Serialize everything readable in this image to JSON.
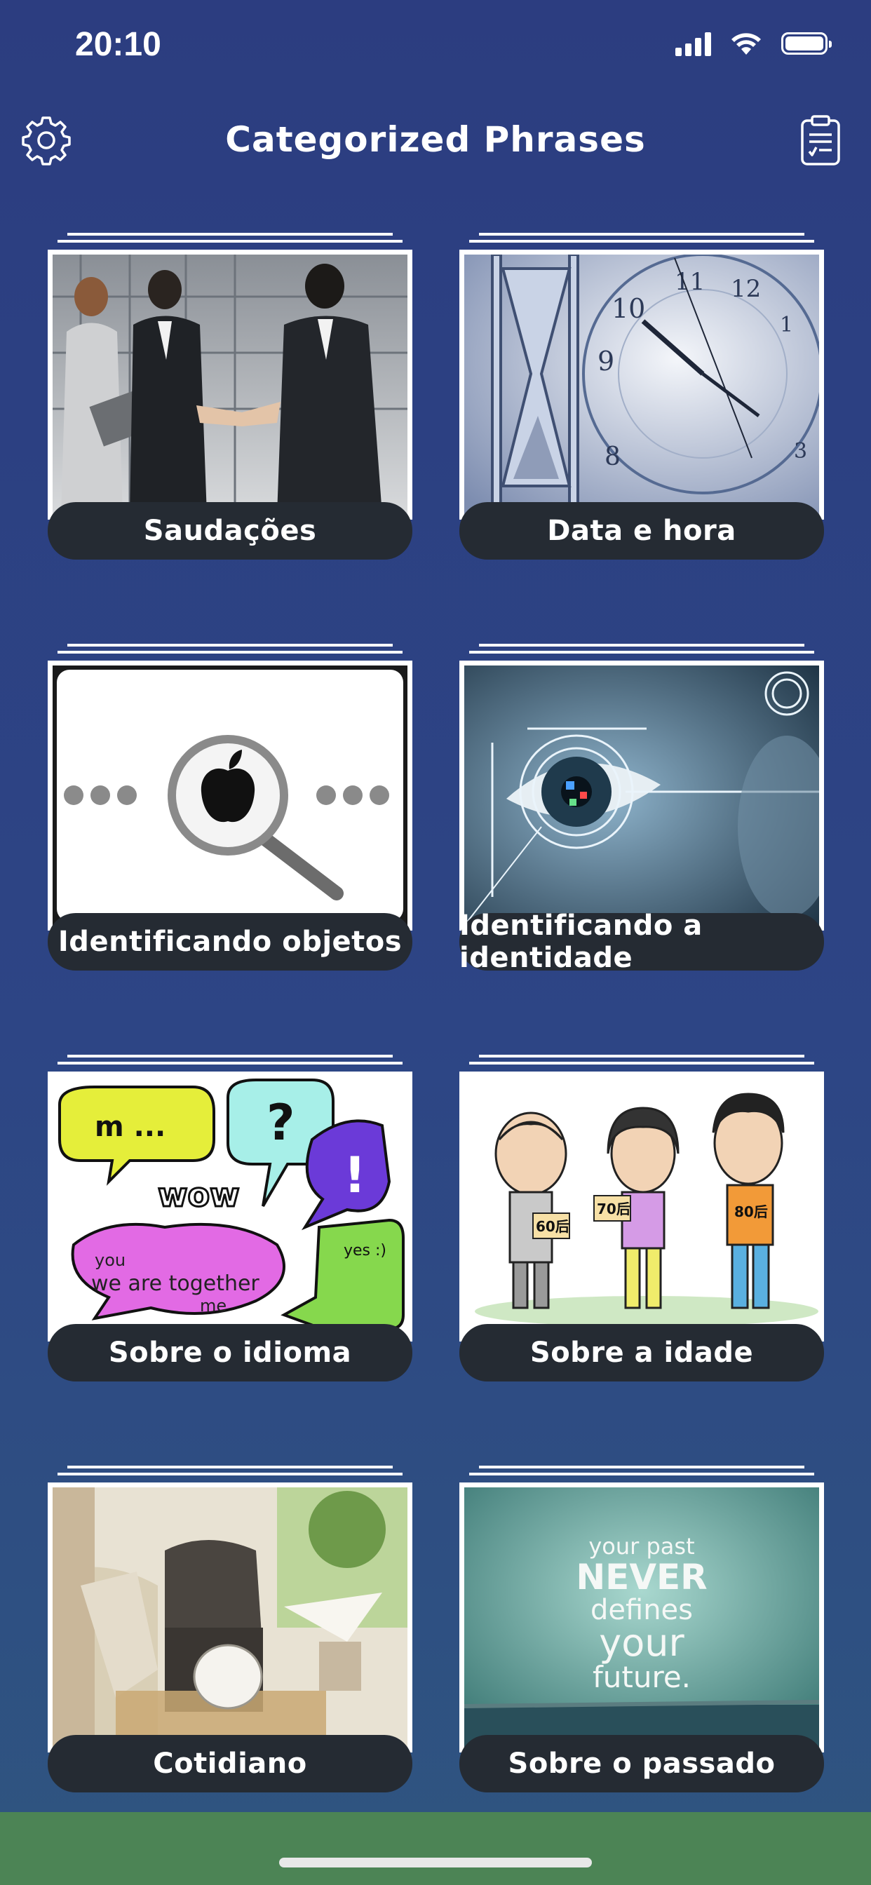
{
  "status_bar": {
    "time": "20:10"
  },
  "header": {
    "title": "Categorized Phrases"
  },
  "categories": [
    {
      "label": "Saudações"
    },
    {
      "label": "Data e hora"
    },
    {
      "label": "Identificando objetos"
    },
    {
      "label": "Identificando a identidade"
    },
    {
      "label": "Sobre o idioma"
    },
    {
      "label": "Sobre a idade"
    },
    {
      "label": "Cotidiano"
    },
    {
      "label": "Sobre o passado"
    }
  ],
  "images": {
    "age_tags": [
      "60后",
      "70后",
      "80后"
    ],
    "past_quote": [
      "your past",
      "NEVER",
      "defines",
      "your",
      "future."
    ],
    "speech_words": [
      "m ...",
      "wow",
      "?",
      "!",
      "yes :)",
      "you",
      "we are together",
      "me"
    ],
    "clock_numbers": [
      "10",
      "11",
      "12",
      "1",
      "9",
      "8",
      "3"
    ]
  },
  "colors": {
    "background": "#2c3d80",
    "label_pill": "#252b33",
    "bottom_bar": "#4c8455"
  }
}
